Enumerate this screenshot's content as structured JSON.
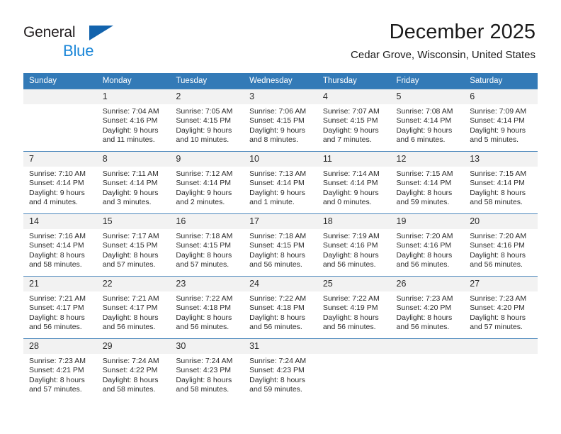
{
  "brand": {
    "name_part1": "General",
    "name_part2": "Blue",
    "triangle_icon": "triangle-logo-icon",
    "color_dark": "#231f20",
    "color_blue": "#1a86d8",
    "color_triangle": "#1263ad"
  },
  "header": {
    "month_title": "December 2025",
    "location": "Cedar Grove, Wisconsin, United States"
  },
  "theme": {
    "header_bg": "#337ab7",
    "header_text": "#ffffff",
    "daynum_bg": "#f2f2f2",
    "row_border": "#4b87bc",
    "body_text": "#2b2b2b"
  },
  "calendar": {
    "weekday_headers": [
      "Sunday",
      "Monday",
      "Tuesday",
      "Wednesday",
      "Thursday",
      "Friday",
      "Saturday"
    ],
    "weeks": [
      [
        {
          "day": "",
          "empty": true,
          "sunrise": "",
          "sunset": "",
          "daylight1": "",
          "daylight2": ""
        },
        {
          "day": "1",
          "empty": false,
          "sunrise": "Sunrise: 7:04 AM",
          "sunset": "Sunset: 4:16 PM",
          "daylight1": "Daylight: 9 hours",
          "daylight2": "and 11 minutes."
        },
        {
          "day": "2",
          "empty": false,
          "sunrise": "Sunrise: 7:05 AM",
          "sunset": "Sunset: 4:15 PM",
          "daylight1": "Daylight: 9 hours",
          "daylight2": "and 10 minutes."
        },
        {
          "day": "3",
          "empty": false,
          "sunrise": "Sunrise: 7:06 AM",
          "sunset": "Sunset: 4:15 PM",
          "daylight1": "Daylight: 9 hours",
          "daylight2": "and 8 minutes."
        },
        {
          "day": "4",
          "empty": false,
          "sunrise": "Sunrise: 7:07 AM",
          "sunset": "Sunset: 4:15 PM",
          "daylight1": "Daylight: 9 hours",
          "daylight2": "and 7 minutes."
        },
        {
          "day": "5",
          "empty": false,
          "sunrise": "Sunrise: 7:08 AM",
          "sunset": "Sunset: 4:14 PM",
          "daylight1": "Daylight: 9 hours",
          "daylight2": "and 6 minutes."
        },
        {
          "day": "6",
          "empty": false,
          "sunrise": "Sunrise: 7:09 AM",
          "sunset": "Sunset: 4:14 PM",
          "daylight1": "Daylight: 9 hours",
          "daylight2": "and 5 minutes."
        }
      ],
      [
        {
          "day": "7",
          "empty": false,
          "sunrise": "Sunrise: 7:10 AM",
          "sunset": "Sunset: 4:14 PM",
          "daylight1": "Daylight: 9 hours",
          "daylight2": "and 4 minutes."
        },
        {
          "day": "8",
          "empty": false,
          "sunrise": "Sunrise: 7:11 AM",
          "sunset": "Sunset: 4:14 PM",
          "daylight1": "Daylight: 9 hours",
          "daylight2": "and 3 minutes."
        },
        {
          "day": "9",
          "empty": false,
          "sunrise": "Sunrise: 7:12 AM",
          "sunset": "Sunset: 4:14 PM",
          "daylight1": "Daylight: 9 hours",
          "daylight2": "and 2 minutes."
        },
        {
          "day": "10",
          "empty": false,
          "sunrise": "Sunrise: 7:13 AM",
          "sunset": "Sunset: 4:14 PM",
          "daylight1": "Daylight: 9 hours",
          "daylight2": "and 1 minute."
        },
        {
          "day": "11",
          "empty": false,
          "sunrise": "Sunrise: 7:14 AM",
          "sunset": "Sunset: 4:14 PM",
          "daylight1": "Daylight: 9 hours",
          "daylight2": "and 0 minutes."
        },
        {
          "day": "12",
          "empty": false,
          "sunrise": "Sunrise: 7:15 AM",
          "sunset": "Sunset: 4:14 PM",
          "daylight1": "Daylight: 8 hours",
          "daylight2": "and 59 minutes."
        },
        {
          "day": "13",
          "empty": false,
          "sunrise": "Sunrise: 7:15 AM",
          "sunset": "Sunset: 4:14 PM",
          "daylight1": "Daylight: 8 hours",
          "daylight2": "and 58 minutes."
        }
      ],
      [
        {
          "day": "14",
          "empty": false,
          "sunrise": "Sunrise: 7:16 AM",
          "sunset": "Sunset: 4:14 PM",
          "daylight1": "Daylight: 8 hours",
          "daylight2": "and 58 minutes."
        },
        {
          "day": "15",
          "empty": false,
          "sunrise": "Sunrise: 7:17 AM",
          "sunset": "Sunset: 4:15 PM",
          "daylight1": "Daylight: 8 hours",
          "daylight2": "and 57 minutes."
        },
        {
          "day": "16",
          "empty": false,
          "sunrise": "Sunrise: 7:18 AM",
          "sunset": "Sunset: 4:15 PM",
          "daylight1": "Daylight: 8 hours",
          "daylight2": "and 57 minutes."
        },
        {
          "day": "17",
          "empty": false,
          "sunrise": "Sunrise: 7:18 AM",
          "sunset": "Sunset: 4:15 PM",
          "daylight1": "Daylight: 8 hours",
          "daylight2": "and 56 minutes."
        },
        {
          "day": "18",
          "empty": false,
          "sunrise": "Sunrise: 7:19 AM",
          "sunset": "Sunset: 4:16 PM",
          "daylight1": "Daylight: 8 hours",
          "daylight2": "and 56 minutes."
        },
        {
          "day": "19",
          "empty": false,
          "sunrise": "Sunrise: 7:20 AM",
          "sunset": "Sunset: 4:16 PM",
          "daylight1": "Daylight: 8 hours",
          "daylight2": "and 56 minutes."
        },
        {
          "day": "20",
          "empty": false,
          "sunrise": "Sunrise: 7:20 AM",
          "sunset": "Sunset: 4:16 PM",
          "daylight1": "Daylight: 8 hours",
          "daylight2": "and 56 minutes."
        }
      ],
      [
        {
          "day": "21",
          "empty": false,
          "sunrise": "Sunrise: 7:21 AM",
          "sunset": "Sunset: 4:17 PM",
          "daylight1": "Daylight: 8 hours",
          "daylight2": "and 56 minutes."
        },
        {
          "day": "22",
          "empty": false,
          "sunrise": "Sunrise: 7:21 AM",
          "sunset": "Sunset: 4:17 PM",
          "daylight1": "Daylight: 8 hours",
          "daylight2": "and 56 minutes."
        },
        {
          "day": "23",
          "empty": false,
          "sunrise": "Sunrise: 7:22 AM",
          "sunset": "Sunset: 4:18 PM",
          "daylight1": "Daylight: 8 hours",
          "daylight2": "and 56 minutes."
        },
        {
          "day": "24",
          "empty": false,
          "sunrise": "Sunrise: 7:22 AM",
          "sunset": "Sunset: 4:18 PM",
          "daylight1": "Daylight: 8 hours",
          "daylight2": "and 56 minutes."
        },
        {
          "day": "25",
          "empty": false,
          "sunrise": "Sunrise: 7:22 AM",
          "sunset": "Sunset: 4:19 PM",
          "daylight1": "Daylight: 8 hours",
          "daylight2": "and 56 minutes."
        },
        {
          "day": "26",
          "empty": false,
          "sunrise": "Sunrise: 7:23 AM",
          "sunset": "Sunset: 4:20 PM",
          "daylight1": "Daylight: 8 hours",
          "daylight2": "and 56 minutes."
        },
        {
          "day": "27",
          "empty": false,
          "sunrise": "Sunrise: 7:23 AM",
          "sunset": "Sunset: 4:20 PM",
          "daylight1": "Daylight: 8 hours",
          "daylight2": "and 57 minutes."
        }
      ],
      [
        {
          "day": "28",
          "empty": false,
          "sunrise": "Sunrise: 7:23 AM",
          "sunset": "Sunset: 4:21 PM",
          "daylight1": "Daylight: 8 hours",
          "daylight2": "and 57 minutes."
        },
        {
          "day": "29",
          "empty": false,
          "sunrise": "Sunrise: 7:24 AM",
          "sunset": "Sunset: 4:22 PM",
          "daylight1": "Daylight: 8 hours",
          "daylight2": "and 58 minutes."
        },
        {
          "day": "30",
          "empty": false,
          "sunrise": "Sunrise: 7:24 AM",
          "sunset": "Sunset: 4:23 PM",
          "daylight1": "Daylight: 8 hours",
          "daylight2": "and 58 minutes."
        },
        {
          "day": "31",
          "empty": false,
          "sunrise": "Sunrise: 7:24 AM",
          "sunset": "Sunset: 4:23 PM",
          "daylight1": "Daylight: 8 hours",
          "daylight2": "and 59 minutes."
        },
        {
          "day": "",
          "empty": true,
          "sunrise": "",
          "sunset": "",
          "daylight1": "",
          "daylight2": ""
        },
        {
          "day": "",
          "empty": true,
          "sunrise": "",
          "sunset": "",
          "daylight1": "",
          "daylight2": ""
        },
        {
          "day": "",
          "empty": true,
          "sunrise": "",
          "sunset": "",
          "daylight1": "",
          "daylight2": ""
        }
      ]
    ]
  }
}
